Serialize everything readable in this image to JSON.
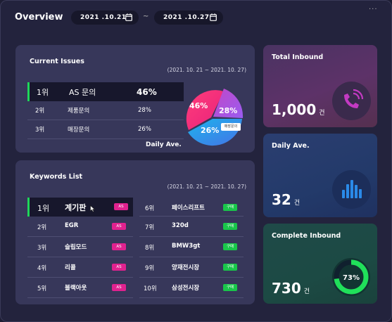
{
  "header": {
    "title": "Overview",
    "date_from": "2021 .10.21",
    "date_to": "2021 .10.27",
    "separator": "~",
    "more_label": "···"
  },
  "current_issues": {
    "title": "Current Issues",
    "range": "(2021. 10. 21 ~ 2021. 10. 27)",
    "rows": [
      {
        "rank": "1위",
        "name": "AS 문의",
        "percent": "46%"
      },
      {
        "rank": "2위",
        "name": "제품문의",
        "percent": "28%"
      },
      {
        "rank": "3위",
        "name": "매장문의",
        "percent": "26%"
      }
    ],
    "pie_labels": [
      "46%",
      "28%",
      "26%"
    ],
    "pie_tooltip": "매장문의",
    "pie_caption": "Daily Ave."
  },
  "keywords": {
    "title": "Keywords List",
    "range": "(2021. 10. 21 ~ 2021. 10. 27)",
    "left": [
      {
        "rank": "1위",
        "name": "계기판",
        "tag": "AS"
      },
      {
        "rank": "2위",
        "name": "EGR",
        "tag": "AS"
      },
      {
        "rank": "3위",
        "name": "슬립모드",
        "tag": "AS"
      },
      {
        "rank": "4위",
        "name": "리콜",
        "tag": "AS"
      },
      {
        "rank": "5위",
        "name": "블랙아웃",
        "tag": "AS"
      }
    ],
    "right": [
      {
        "rank": "6위",
        "name": "페이스리프트",
        "tag": "구매"
      },
      {
        "rank": "7위",
        "name": "320d",
        "tag": "구매"
      },
      {
        "rank": "8위",
        "name": "BMW3gt",
        "tag": "구매"
      },
      {
        "rank": "9위",
        "name": "양재전시장",
        "tag": "구매"
      },
      {
        "rank": "10위",
        "name": "삼성전시장",
        "tag": "구매"
      }
    ]
  },
  "cards": {
    "total_inbound": {
      "title": "Total Inbound",
      "value": "1,000",
      "unit": "건",
      "icon": "phone-icon"
    },
    "daily_ave": {
      "title": "Daily Ave.",
      "value": "32",
      "unit": "건",
      "icon": "bar-chart-icon"
    },
    "complete_inbound": {
      "title": "Complete Inbound",
      "value": "730",
      "unit": "건",
      "progress_label": "73%",
      "progress": 0.73
    }
  },
  "colors": {
    "accent_green": "#1fd65a",
    "as_tag": "#e0228f",
    "buy_tag": "#19c64a"
  }
}
